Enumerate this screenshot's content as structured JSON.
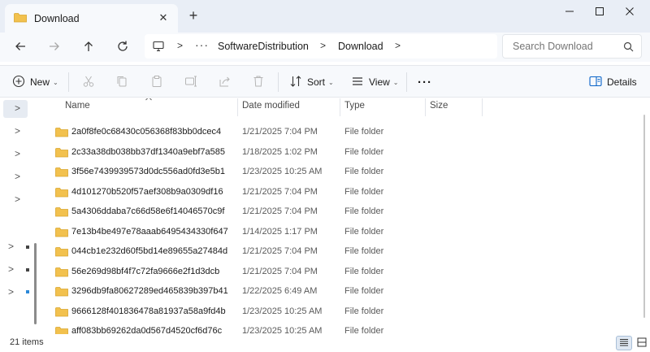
{
  "tab": {
    "title": "Download",
    "close_glyph": "✕",
    "new_tab_glyph": "+"
  },
  "window": {
    "minimize_glyph": "—",
    "close_glyph": "✕"
  },
  "address": {
    "ellipsis": "···",
    "breadcrumbs": [
      "SoftwareDistribution",
      "Download"
    ],
    "separator": ">"
  },
  "search": {
    "placeholder": "Search Download"
  },
  "toolbar": {
    "new_label": "New",
    "sort_label": "Sort",
    "view_label": "View",
    "more_label": "···",
    "details_label": "Details",
    "dropdown_glyph": "⌄"
  },
  "columns": {
    "name": "Name",
    "date": "Date modified",
    "type": "Type",
    "size": "Size"
  },
  "files": [
    {
      "name": "2a0f8fe0c68430c056368f83bb0dcec4",
      "date": "1/21/2025 7:04 PM",
      "type": "File folder"
    },
    {
      "name": "2c33a38db038bb37df1340a9ebf7a585",
      "date": "1/18/2025 1:02 PM",
      "type": "File folder"
    },
    {
      "name": "3f56e7439939573d0dc556ad0fd3e5b1",
      "date": "1/23/2025 10:25 AM",
      "type": "File folder"
    },
    {
      "name": "4d101270b520f57aef308b9a0309df16",
      "date": "1/21/2025 7:04 PM",
      "type": "File folder"
    },
    {
      "name": "5a4306ddaba7c66d58e6f14046570c9f",
      "date": "1/21/2025 7:04 PM",
      "type": "File folder"
    },
    {
      "name": "7e13b4be497e78aaab6495434330f647",
      "date": "1/14/2025 1:17 PM",
      "type": "File folder"
    },
    {
      "name": "044cb1e232d60f5bd14e89655a27484d",
      "date": "1/21/2025 7:04 PM",
      "type": "File folder"
    },
    {
      "name": "56e269d98bf4f7c72fa9666e2f1d3dcb",
      "date": "1/21/2025 7:04 PM",
      "type": "File folder"
    },
    {
      "name": "3296db9fa80627289ed465839b397b41",
      "date": "1/22/2025 6:49 AM",
      "type": "File folder"
    },
    {
      "name": "9666128f401836478a81937a58a9fd4b",
      "date": "1/23/2025 10:25 AM",
      "type": "File folder"
    },
    {
      "name": "aff083bb69262da0d567d4520cf6d76c",
      "date": "1/23/2025 10:25 AM",
      "type": "File folder"
    }
  ],
  "nav_chevron": ">",
  "status": {
    "item_count": "21 items"
  },
  "icons": {
    "folder": "folder-icon",
    "back": "arrow-left-icon",
    "forward": "arrow-right-icon",
    "up": "arrow-up-icon",
    "refresh": "refresh-icon",
    "search": "search-icon"
  },
  "colors": {
    "folder": "#f2c14e",
    "accent": "#0a64c8",
    "chrome": "#e9eef6"
  }
}
